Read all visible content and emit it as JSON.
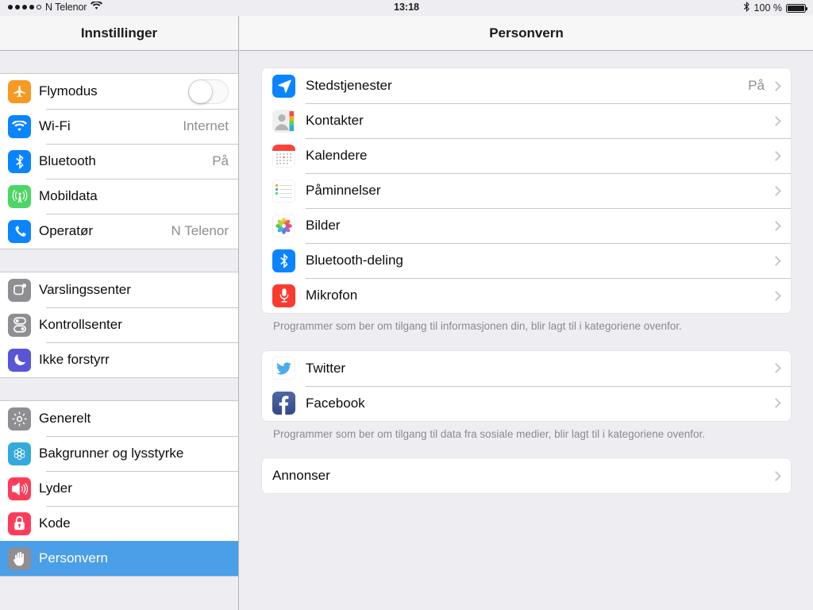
{
  "statusbar": {
    "signal_filled": 4,
    "signal_empty": 1,
    "carrier": "N Telenor",
    "wifi_icon": "wifi-icon",
    "time": "13:18",
    "bluetooth_icon": "bluetooth-icon",
    "battery_text": "100 %",
    "battery_level": 100
  },
  "sidebar": {
    "title": "Innstillinger",
    "groups": [
      {
        "rows": [
          {
            "label": "Flymodus",
            "icon": "airplane-icon",
            "color": "#f59a23",
            "control": "toggle",
            "toggle_on": false
          },
          {
            "label": "Wi-Fi",
            "icon": "wifi-icon",
            "color": "#0b84ff",
            "value": "Internet"
          },
          {
            "label": "Bluetooth",
            "icon": "bluetooth-icon",
            "color": "#0b84ff",
            "value": "På"
          },
          {
            "label": "Mobildata",
            "icon": "cellular-icon",
            "color": "#4cd663",
            "value": ""
          },
          {
            "label": "Operatør",
            "icon": "phone-icon",
            "color": "#0b84ff",
            "value": "N Telenor"
          }
        ]
      },
      {
        "rows": [
          {
            "label": "Varslingssenter",
            "icon": "notification-center-icon",
            "color": "#8e8e93",
            "value": ""
          },
          {
            "label": "Kontrollsenter",
            "icon": "control-center-icon",
            "color": "#8e8e93",
            "value": ""
          },
          {
            "label": "Ikke forstyrr",
            "icon": "moon-icon",
            "color": "#5856d6",
            "value": ""
          }
        ]
      },
      {
        "rows": [
          {
            "label": "Generelt",
            "icon": "gear-icon",
            "color": "#8e8e93",
            "value": ""
          },
          {
            "label": "Bakgrunner og lysstyrke",
            "icon": "wallpaper-flower-icon",
            "color": "#34aadc",
            "value": ""
          },
          {
            "label": "Lyder",
            "icon": "speaker-icon",
            "color": "#fc3d5a",
            "value": ""
          },
          {
            "label": "Kode",
            "icon": "lock-icon",
            "color": "#fc3d5a",
            "value": ""
          },
          {
            "label": "Personvern",
            "icon": "hand-icon",
            "color": "#8e8e93",
            "value": "",
            "selected": true
          }
        ]
      }
    ]
  },
  "detail": {
    "title": "Personvern",
    "sections": [
      {
        "rows": [
          {
            "label": "Stedstjenester",
            "icon": "location-arrow-icon",
            "color": "#0b84ff",
            "value": "På"
          },
          {
            "label": "Kontakter",
            "icon": "contacts-icon",
            "color": "#f2f2f2",
            "value": ""
          },
          {
            "label": "Kalendere",
            "icon": "calendar-icon",
            "color": "#ffffff",
            "value": ""
          },
          {
            "label": "Påminnelser",
            "icon": "reminders-icon",
            "color": "#ffffff",
            "value": ""
          },
          {
            "label": "Bilder",
            "icon": "photos-icon",
            "color": "#ffffff",
            "value": ""
          },
          {
            "label": "Bluetooth-deling",
            "icon": "bluetooth-icon",
            "color": "#0b84ff",
            "value": ""
          },
          {
            "label": "Mikrofon",
            "icon": "microphone-icon",
            "color": "#fb3b30",
            "value": ""
          }
        ],
        "footer": "Programmer som ber om tilgang til informasjonen din, blir lagt til i kategoriene ovenfor."
      },
      {
        "rows": [
          {
            "label": "Twitter",
            "icon": "twitter-icon",
            "color": "#ffffff",
            "value": ""
          },
          {
            "label": "Facebook",
            "icon": "facebook-icon",
            "color": "#3b5998",
            "value": ""
          }
        ],
        "footer": "Programmer som ber om tilgang til data fra sosiale medier, blir lagt til i kategoriene ovenfor."
      },
      {
        "rows": [
          {
            "label": "Annonser",
            "icon": "",
            "color": "",
            "value": ""
          }
        ],
        "footer": ""
      }
    ]
  },
  "colors": {
    "selection_blue": "#4a9fe8",
    "background": "#eeeef2",
    "separator": "#c8c7cc",
    "secondary_text": "#8e8e93"
  }
}
